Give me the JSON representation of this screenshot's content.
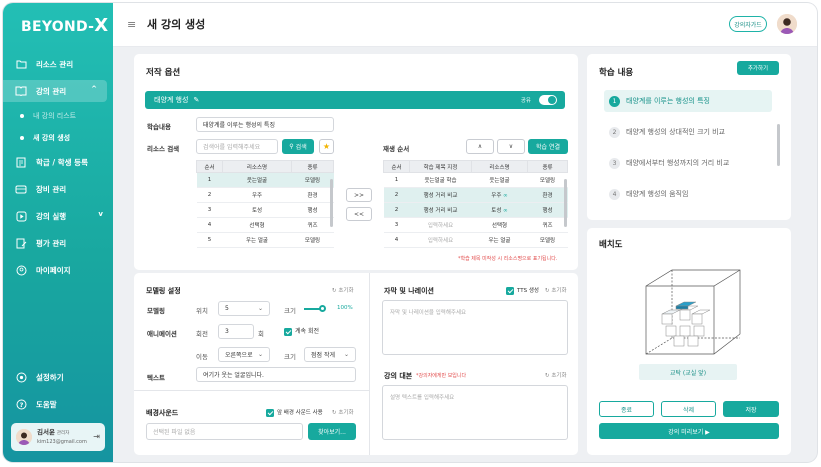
{
  "app": {
    "logo_text": "BEYOND-",
    "logo_x": "X",
    "page_title": "새 강의 생성",
    "guide_button": "강의자가드"
  },
  "sidebar": {
    "items": [
      {
        "label": "리소스 관리",
        "icon": "folder-icon"
      },
      {
        "label": "강의 관리",
        "icon": "book-icon"
      },
      {
        "label": "학급 / 학생 등록",
        "icon": "document-icon"
      },
      {
        "label": "장비 관리",
        "icon": "device-icon"
      },
      {
        "label": "강의 실행",
        "icon": "play-icon"
      },
      {
        "label": "평가 관리",
        "icon": "edit-icon"
      },
      {
        "label": "마이페이지",
        "icon": "user-icon"
      }
    ],
    "sub_items": [
      {
        "label": "내 강의 리스트"
      },
      {
        "label": "새 강의 생성"
      }
    ],
    "bottom": [
      {
        "label": "설정하기",
        "icon": "gear-icon"
      },
      {
        "label": "도움말",
        "icon": "help-icon"
      }
    ],
    "user": {
      "name": "김서윤",
      "role": "관리자",
      "email": "kim123@gmail.com"
    }
  },
  "editor": {
    "section_title": "저작 옵션",
    "lesson_banner": "태양계 행성",
    "share_label": "공유",
    "learning_label": "학습내용",
    "learning_value": "태양계를 이루는 행성의 특징",
    "resource_search_label": "리소스 검색",
    "search_placeholder": "검색어를 입력해주세요",
    "search_button": "검색",
    "playback_label": "재생 순서",
    "apply_button": "학습 연결",
    "move_right": ">>",
    "move_left": "<<",
    "resource_table": {
      "headers": [
        "순서",
        "리소스명",
        "종류"
      ],
      "rows": [
        [
          "1",
          "웃는얼굴",
          "모델링"
        ],
        [
          "2",
          "우주",
          "환경"
        ],
        [
          "3",
          "토성",
          "행성"
        ],
        [
          "4",
          "선택형",
          "퀴즈"
        ],
        [
          "5",
          "우는 얼굴",
          "모델링"
        ]
      ]
    },
    "playback_table": {
      "headers": [
        "순서",
        "학습 제목 지정",
        "리소스명",
        "종류"
      ],
      "rows": [
        [
          "1",
          "웃는얼굴 학습",
          "웃는얼굴",
          "모델링"
        ],
        [
          "2",
          "행성 거리 비교",
          "우주",
          "환경"
        ],
        [
          "2",
          "행성 거리 비교",
          "토성",
          "행성"
        ],
        [
          "3",
          "입력하세요",
          "선택형",
          "퀴즈"
        ],
        [
          "4",
          "입력하세요",
          "우는 얼굴",
          "모델링"
        ]
      ]
    },
    "warning": "*학습 제목 미작성 시 리소스명으로 표기됩니다."
  },
  "modeling": {
    "title": "모델링 설정",
    "reset": "초기화",
    "model_label": "모델링",
    "position_label": "위치",
    "position_value": "5",
    "size_label": "크기",
    "size_value": "100%",
    "size_fraction": 1.0,
    "anim_label": "애니메이션",
    "rotate_label": "회전",
    "rotate_value": "3",
    "rotate_unit": "회",
    "continuous_label": "계속 회전",
    "move_label": "이동",
    "move_value": "오른쪽으로",
    "size2_label": "크기",
    "size2_value": "점점 작게",
    "text_label": "텍스트",
    "text_value": "여기가 웃는 얼굴입니다."
  },
  "subtitle": {
    "title": "자막 및 나레이션",
    "tts_label": "TTS 생성",
    "reset": "초기화",
    "placeholder": "자막 및 나레이션을 입력해주세요",
    "script_title": "강의 대본",
    "script_note": "*강의자에게만 보입니다",
    "script_placeholder": "설명 텍스트를 입력해주세요"
  },
  "bgsound": {
    "title": "배경사운드",
    "all_label": "앞 배경 사운드 사용",
    "reset": "초기화",
    "file_placeholder": "선택된 파일 없음",
    "find_button": "찾아보기..."
  },
  "learning_contents": {
    "title": "학습 내용",
    "add_button": "추가하기",
    "items": [
      {
        "num": "1",
        "label": "태양계를 이루는 행성의 특징"
      },
      {
        "num": "2",
        "label": "태양계 행성의 상대적인 크기 비교"
      },
      {
        "num": "3",
        "label": "태양에서부터 행성까지의 거리 비교"
      },
      {
        "num": "4",
        "label": "태양계 행성의 움직임"
      }
    ]
  },
  "placement": {
    "title": "배치도",
    "location": "교탁 (교실 앞)",
    "btn_end": "종료",
    "btn_delete": "삭제",
    "btn_save": "저장",
    "btn_preview": "강의 미리보기 ▶"
  },
  "colors": {
    "accent": "#17a99e",
    "sidebar": "#1fb3a8",
    "warning": "#e24b4b"
  }
}
